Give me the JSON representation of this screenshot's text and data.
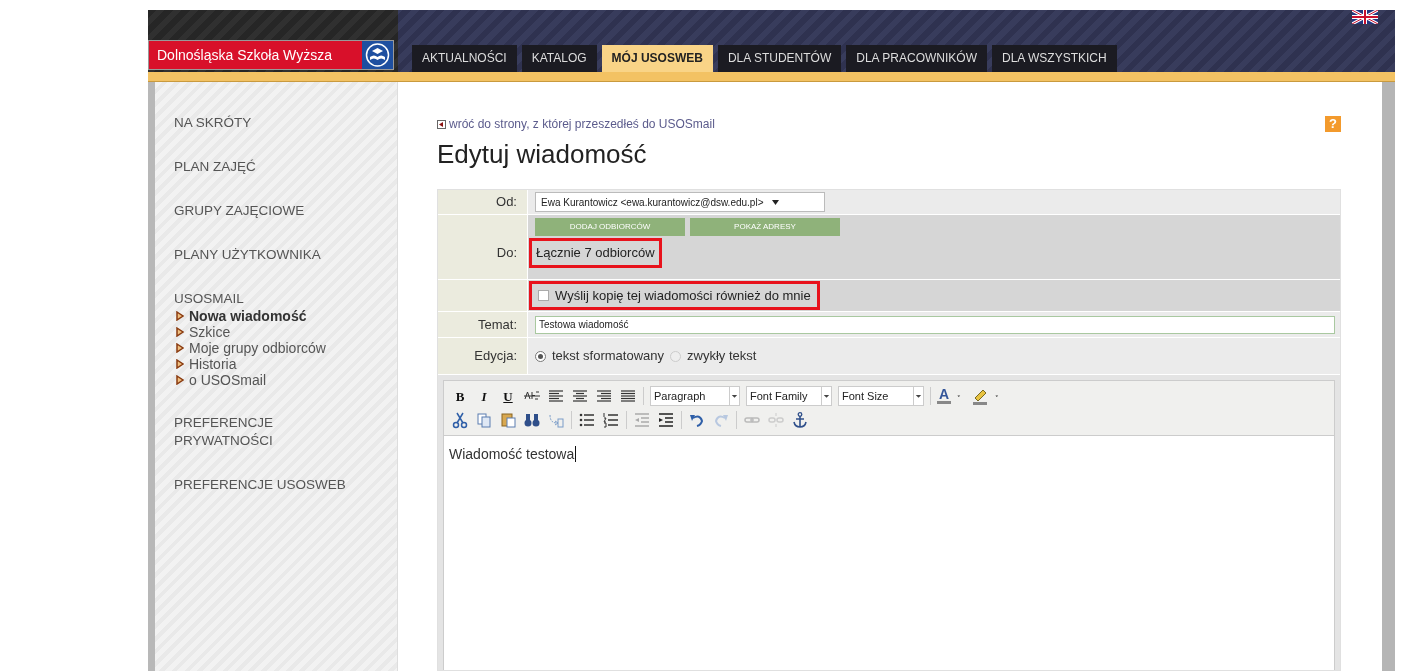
{
  "header": {
    "logo_text": "Dolnośląska Szkoła Wyższa",
    "tabs": [
      {
        "label": "AKTUALNOŚCI",
        "selected": false
      },
      {
        "label": "KATALOG",
        "selected": false
      },
      {
        "label": "MÓJ USOSWEB",
        "selected": true
      },
      {
        "label": "DLA STUDENTÓW",
        "selected": false
      },
      {
        "label": "DLA PRACOWNIKÓW",
        "selected": false
      },
      {
        "label": "DLA WSZYSTKICH",
        "selected": false
      }
    ]
  },
  "sidebar": {
    "items": [
      {
        "label": "NA SKRÓTY"
      },
      {
        "label": "PLAN ZAJĘĆ"
      },
      {
        "label": "GRUPY ZAJĘCIOWE"
      },
      {
        "label": "PLANY UŻYTKOWNIKA"
      },
      {
        "label": "USOSMAIL",
        "children": [
          {
            "label": "Nowa wiadomość",
            "selected": true
          },
          {
            "label": "Szkice",
            "selected": false
          },
          {
            "label": "Moje grupy odbiorców",
            "selected": false
          },
          {
            "label": "Historia",
            "selected": false
          },
          {
            "label": "o USOSmail",
            "selected": false
          }
        ]
      },
      {
        "label": "PREFERENCJE PRYWATNOŚCI"
      },
      {
        "label": "PREFERENCJE USOSWEB"
      }
    ]
  },
  "back_link": "wróć do strony, z której przeszedłeś do USOSmail",
  "help": "?",
  "title": "Edytuj wiadomość",
  "form": {
    "from": {
      "label": "Od:",
      "value": "Ewa Kurantowicz <ewa.kurantowicz@dsw.edu.pl>"
    },
    "to": {
      "label": "Do:",
      "buttons": [
        "DODAJ ODBIORCÓW",
        "POKAŻ ADRESY"
      ],
      "summary": "Łącznie 7 odbiorców",
      "highlighted": true
    },
    "copy_to_me": {
      "label": "Wyślij kopię tej wiadomości również do mnie",
      "checked": false,
      "highlighted": true
    },
    "subject": {
      "label": "Temat:",
      "value": "Testowa wiadomość"
    },
    "mode": {
      "label": "Edycja:",
      "options": [
        {
          "label": "tekst sformatowany",
          "selected": true
        },
        {
          "label": "zwykły tekst",
          "selected": false
        }
      ]
    }
  },
  "editor": {
    "format_buttons": [
      "B",
      "I",
      "U"
    ],
    "dropdowns": [
      "Paragraph",
      "Font Family",
      "Font Size"
    ],
    "color_button": "A",
    "body": "Wiadomość testowa"
  }
}
